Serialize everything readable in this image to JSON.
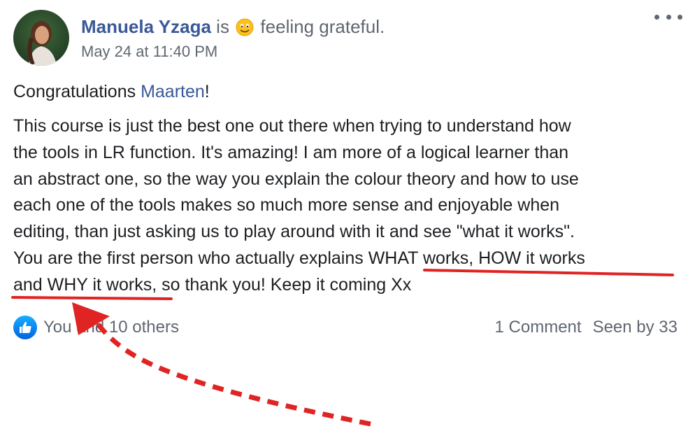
{
  "post": {
    "author": "Manuela Yzaga",
    "status_prefix": "is",
    "feeling": "feeling grateful.",
    "timestamp": "May 24 at 11:40 PM",
    "greeting": "Congratulations ",
    "mention": "Maarten",
    "greeting_end": "!",
    "body_lines": [
      "This course is just the best one out there when trying to understand how",
      "the tools in LR function. It's amazing! I am more of a logical learner than",
      "an abstract one, so the way you explain the colour theory and how to use",
      "each one of the tools makes so much more sense and enjoyable when",
      "editing, than just asking us to play around with it and see \"what it works\".",
      "You are the first person who actually explains ",
      "WHAT works, HOW it works",
      "and WHY it works",
      ", so thank you! Keep it coming Xx"
    ]
  },
  "footer": {
    "likes": "You and 10 others",
    "comments": "1 Comment",
    "seen": "Seen by 33"
  },
  "icons": {
    "more": "more-options-icon",
    "like": "like-thumb-icon",
    "feeling": "grateful-emoji-icon"
  },
  "colors": {
    "link": "#385898",
    "muted": "#606770",
    "annotation": "#e02424",
    "like_badge": "#1877f2"
  }
}
